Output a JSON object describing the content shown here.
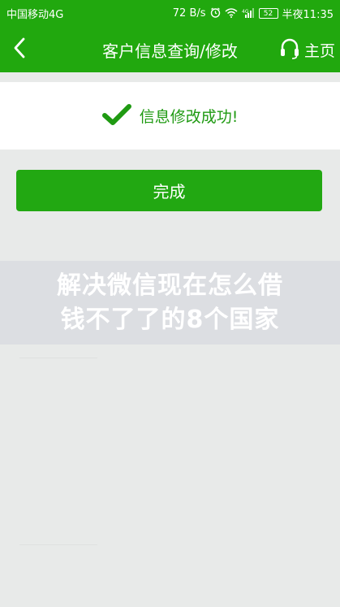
{
  "status_bar": {
    "carrier": "中国移动4G",
    "speed": "72 B/s",
    "signal_label": "⁴ᴳ",
    "battery": "52",
    "time": "半夜11:35"
  },
  "header": {
    "title": "客户信息查询/修改",
    "home_label": "主页"
  },
  "success": {
    "message": "信息修改成功!"
  },
  "actions": {
    "done_label": "完成"
  },
  "overlay": {
    "line1": "解决微信现在怎么借",
    "line2": "钱不了了的8个国家"
  },
  "colors": {
    "brand_green": "#21a80e",
    "check_green": "#1f9a12",
    "background": "#e8eae9"
  },
  "icons": {
    "back": "chevron-left-icon",
    "home": "headset-icon",
    "success": "checkmark-icon"
  }
}
